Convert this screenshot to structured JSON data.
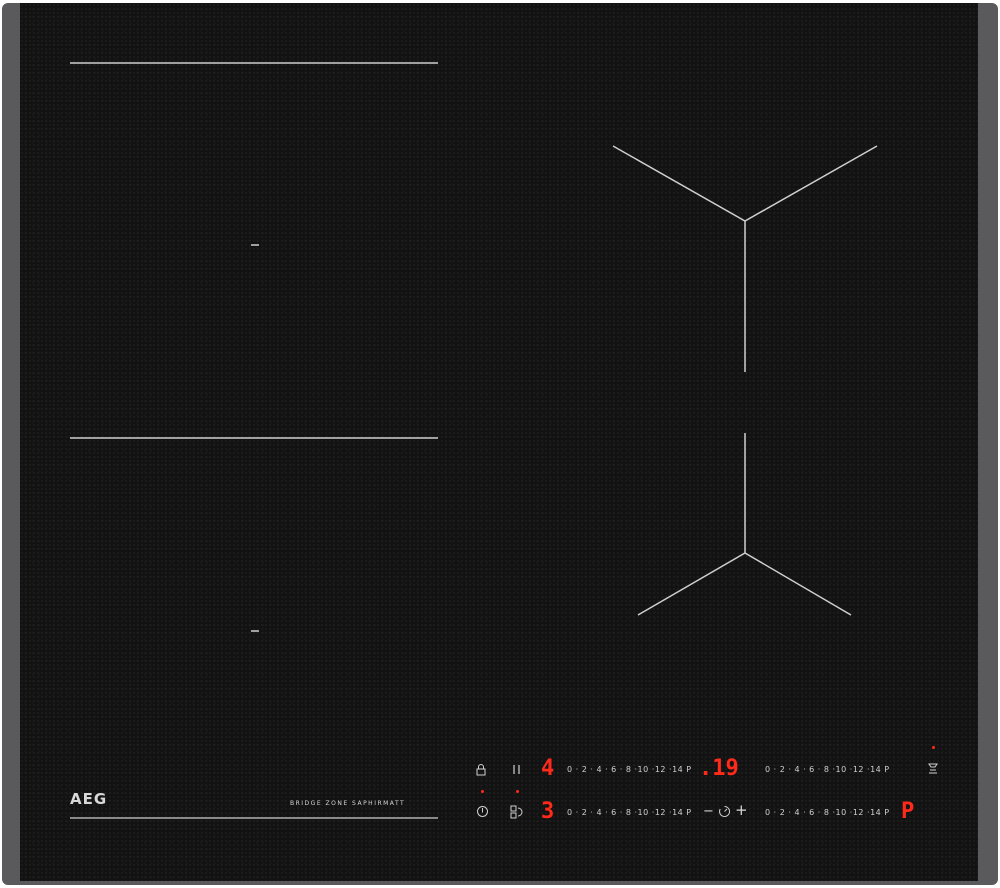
{
  "brand": "AEG",
  "tagline": "BRIDGE ZONE SAPHIRMATT",
  "controls": {
    "lock_icon": "lock-icon",
    "pause_icon": "pause-icon",
    "power_icon": "power-icon",
    "bridge_icon": "bridge-icon",
    "timer_icon": "timer-icon",
    "hob2hood_icon": "hob2hood-icon",
    "top_left_display": "4",
    "top_right_display": ".19",
    "bottom_left_display": "3",
    "bottom_right_display": "P",
    "top_left_scale": "0 · 2 · 4 · 6 · 8 ·10 ·12 ·14 P",
    "top_right_scale": "0 · 2 · 4 · 6 · 8 ·10 ·12 ·14 P",
    "bottom_left_scale": "0 · 2 · 4 · 6 · 8 ·10 ·12 ·14 P",
    "bottom_right_scale": "0 · 2 · 4 · 6 · 8 ·10 ·12 ·14 P",
    "minus_label": "−",
    "plus_label": "+"
  },
  "colors": {
    "glass": "#121212",
    "frame": "#5a5a5c",
    "display_red": "#ff2a1a",
    "print_white": "#d9d9d9"
  }
}
